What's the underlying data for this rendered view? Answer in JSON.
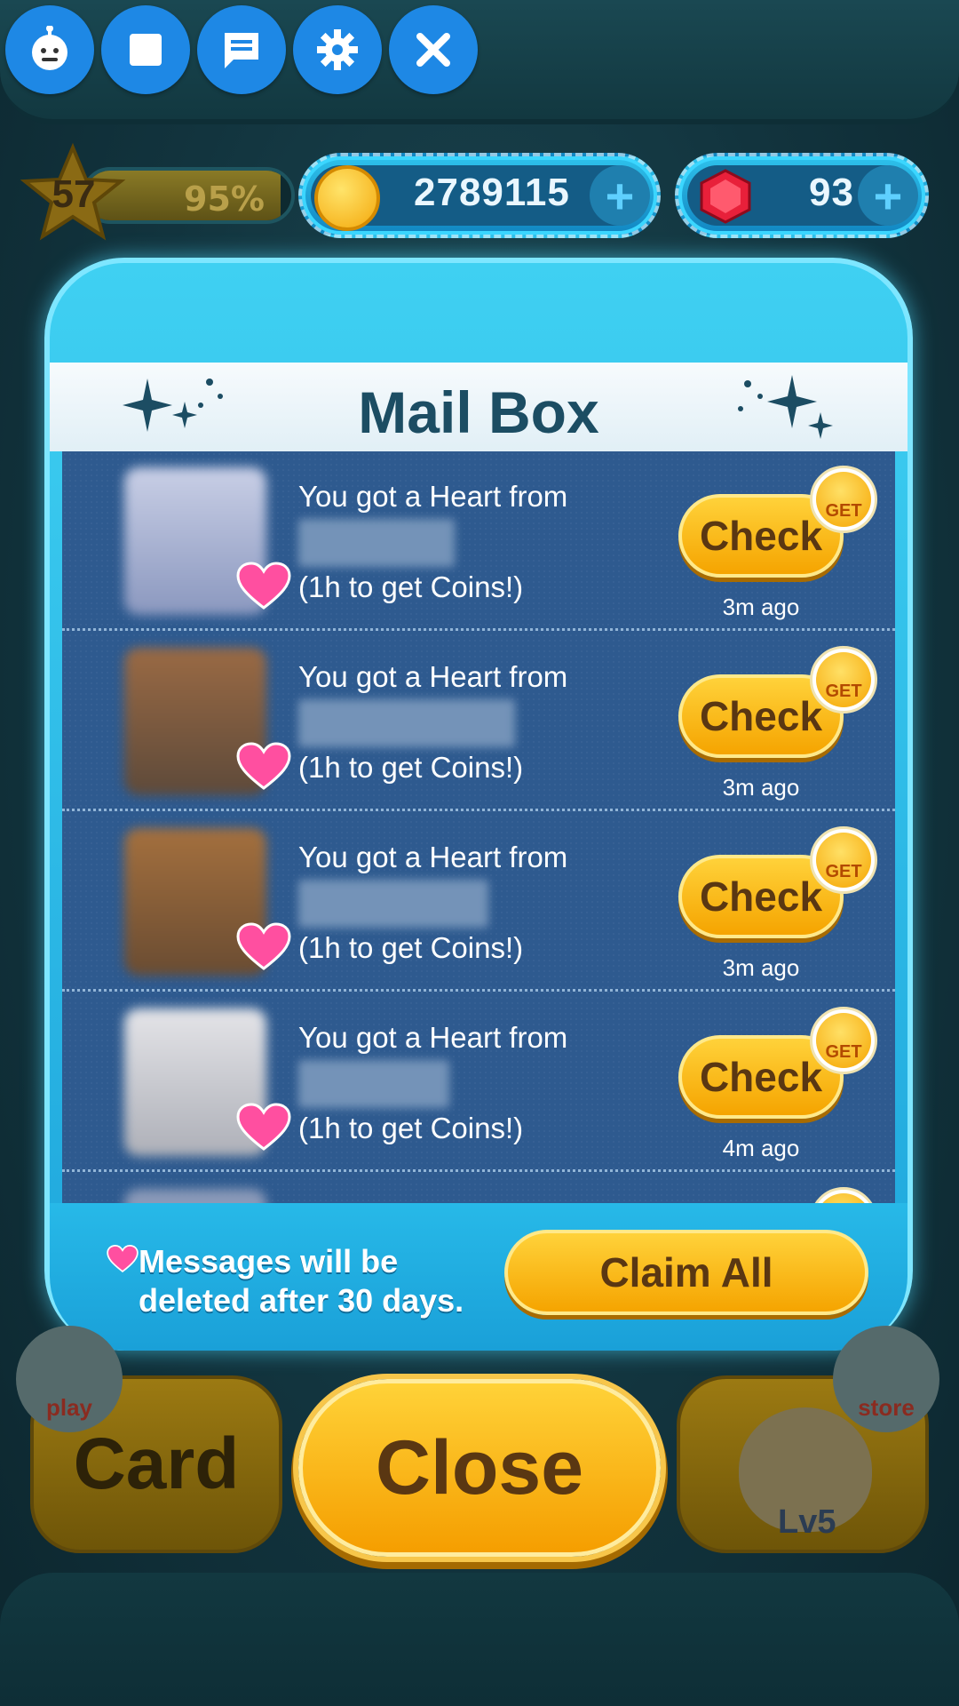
{
  "overlay": {
    "buttons": [
      {
        "icon": "robot-icon"
      },
      {
        "icon": "stop-icon"
      },
      {
        "icon": "chat-icon"
      },
      {
        "icon": "gear-icon"
      },
      {
        "icon": "close-icon"
      }
    ]
  },
  "stats": {
    "level": "57",
    "level_progress": "95%",
    "level_progress_value": 0.95,
    "coins": "2789115",
    "gems": "93"
  },
  "mailbox": {
    "title": "Mail Box",
    "messages": [
      {
        "line1": "You got a Heart from",
        "line3": "(1h to get Coins!)",
        "button": "Check",
        "badge": "GET",
        "time": "3m ago"
      },
      {
        "line1": "You got a Heart from",
        "line3": "(1h to get Coins!)",
        "button": "Check",
        "badge": "GET",
        "time": "3m ago"
      },
      {
        "line1": "You got a Heart from",
        "line3": "(1h to get Coins!)",
        "button": "Check",
        "badge": "GET",
        "time": "3m ago"
      },
      {
        "line1": "You got a Heart from",
        "line3": "(1h to get Coins!)",
        "button": "Check",
        "badge": "GET",
        "time": "4m ago"
      }
    ],
    "footer_note_line1": "Messages will be",
    "footer_note_line2": "deleted after 30 days.",
    "claim_all": "Claim All"
  },
  "bottom": {
    "card": "Card",
    "play_badge": "play",
    "close": "Close",
    "store_badge": "store",
    "lv_label": "Lv5"
  },
  "colors": {
    "accent_blue": "#1ea6dc",
    "button_gold": "#f5a400",
    "heart_pink": "#ff4fa0"
  }
}
